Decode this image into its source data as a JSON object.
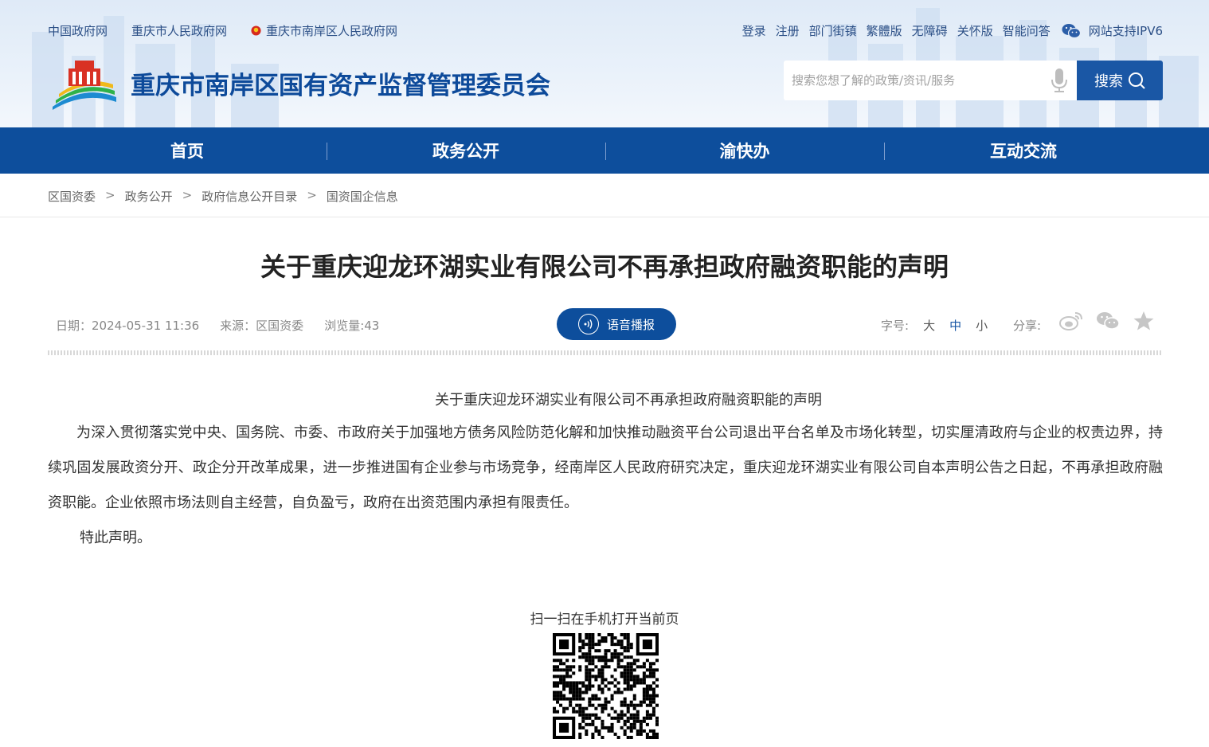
{
  "top_links": {
    "left": [
      "中国政府网",
      "重庆市人民政府网",
      "重庆市南岸区人民政府网"
    ],
    "right": [
      "登录",
      "注册",
      "部门街镇",
      "繁體版",
      "无障碍",
      "关怀版",
      "智能问答"
    ],
    "ipv6": "网站支持IPV6"
  },
  "site": {
    "title": "重庆市南岸区国有资产监督管理委员会"
  },
  "search": {
    "placeholder": "搜索您想了解的政策/资讯/服务",
    "button": "搜索"
  },
  "nav": [
    "首页",
    "政务公开",
    "渝快办",
    "互动交流"
  ],
  "breadcrumb": [
    "区国资委",
    "政务公开",
    "政府信息公开目录",
    "国资国企信息"
  ],
  "breadcrumb_sep": ">",
  "article": {
    "title": "关于重庆迎龙环湖实业有限公司不再承担政府融资职能的声明",
    "date": "日期：2024-05-31 11:36",
    "source": "来源：区国资委",
    "views": "浏览量:43",
    "voice": "语音播报",
    "font_label": "字号:",
    "font_sizes": [
      "大",
      "中",
      "小"
    ],
    "share_label": "分享:",
    "body_title": "关于重庆迎龙环湖实业有限公司不再承担政府融资职能的声明",
    "body": "为深入贯彻落实党中央、国务院、市委、市政府关于加强地方债务风险防范化解和加快推动融资平台公司退出平台名单及市场化转型，切实厘清政府与企业的权责边界，持续巩固发展政资分开、政企分开改革成果，进一步推进国有企业参与市场竞争，经南岸区人民政府研究决定，重庆迎龙环湖实业有限公司自本声明公告之日起，不再承担政府融资职能。企业依照市场法则自主经营，自负盈亏，政府在出资范围内承担有限责任。",
    "closing": "特此声明。"
  },
  "qr": {
    "label": "扫一扫在手机打开当前页"
  },
  "colors": {
    "primary": "#0d4e9c",
    "title_blue": "#0d4a9a",
    "link": "#2b4f86"
  },
  "icons": [
    "emblem-icon",
    "wechat-icon",
    "logo-icon",
    "microphone-icon",
    "search-icon",
    "voice-icon",
    "weibo-icon",
    "wechat-share-icon",
    "favorite-star-icon",
    "qr-code-icon"
  ]
}
